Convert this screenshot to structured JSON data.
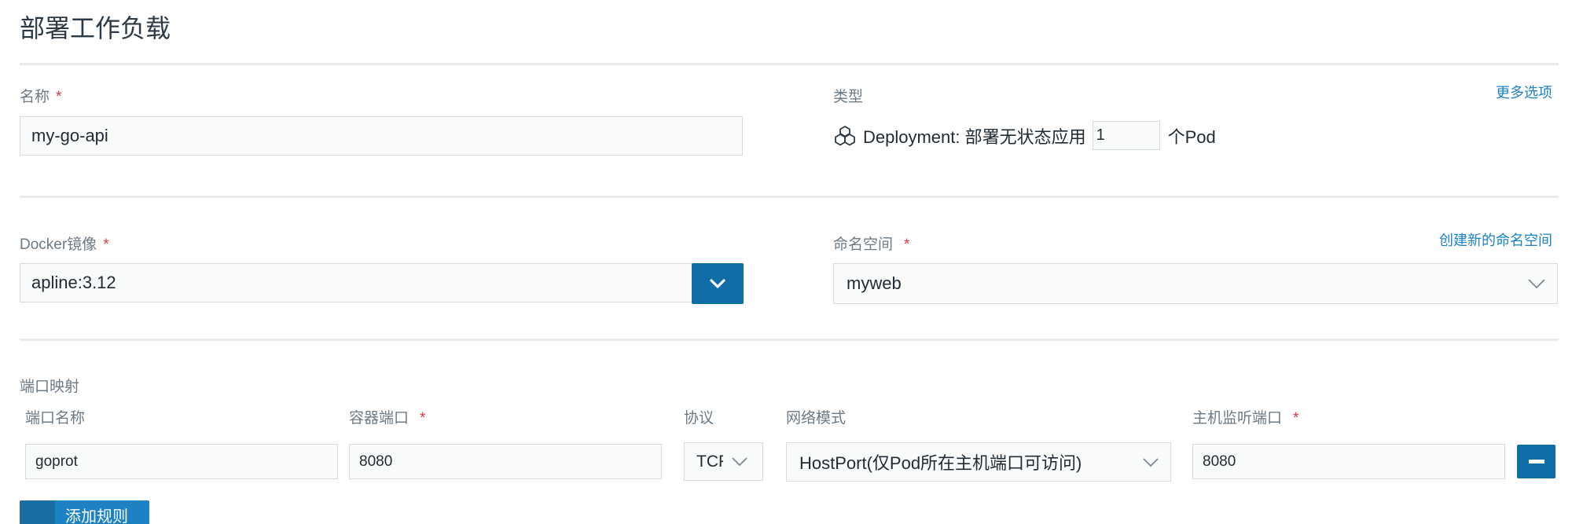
{
  "page": {
    "title": "部署工作负载"
  },
  "name_field": {
    "label": "名称",
    "required": "*",
    "value": "my-go-api"
  },
  "type_field": {
    "label": "类型",
    "more_options": "更多选项",
    "workload_icon": "cube-cluster-icon",
    "workload_text": "Deployment: 部署无状态应用",
    "replicas": "1",
    "replicas_suffix": "个Pod"
  },
  "image_field": {
    "label": "Docker镜像",
    "required": "*",
    "value": "apline:3.12",
    "dropdown_icon": "chevron-down-icon"
  },
  "namespace_field": {
    "label": "命名空间",
    "required": "*",
    "create_link": "创建新的命名空间",
    "value": "myweb"
  },
  "port_mapping": {
    "section_label": "端口映射",
    "columns": {
      "port_name": "端口名称",
      "container_port": "容器端口",
      "protocol": "协议",
      "network_mode": "网络模式",
      "host_port": "主机监听端口"
    },
    "required": "*",
    "rows": [
      {
        "port_name": "goprot",
        "container_port": "8080",
        "protocol": "TCP",
        "network_mode": "HostPort(仅Pod所在主机端口可访问)",
        "host_port": "8080"
      }
    ],
    "remove_icon": "minus-icon",
    "add_rule_label": "添加规则"
  },
  "colors": {
    "accent": "#1c82c3",
    "button": "#0f6ea8",
    "required": "#e0373f"
  }
}
